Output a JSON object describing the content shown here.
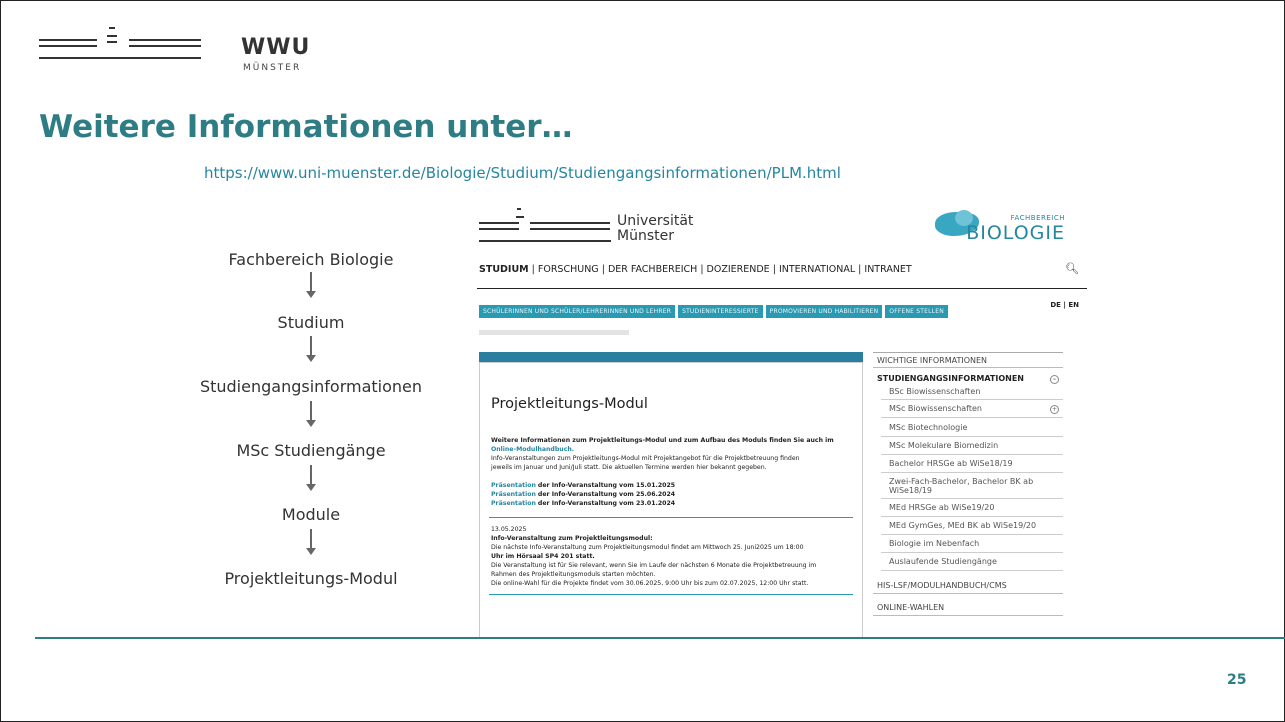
{
  "logo": {
    "word": "WWU",
    "sub": "MÜNSTER"
  },
  "title": "Weitere Informationen unter…",
  "url": "https://www.uni-muenster.de/Biologie/Studium/Studiengangsinformationen/PLM.html",
  "flow": [
    "Fachbereich Biologie",
    "Studium",
    "Studiengangsinformationen",
    "MSc Studiengänge",
    "Module",
    "Projektleitungs-Modul"
  ],
  "screenshot": {
    "uni_name_1": "Universität",
    "uni_name_2": "Münster",
    "bio_small": "FACHBEREICH",
    "bio_big": "BIOLOGIE",
    "nav": [
      "STUDIUM",
      "FORSCHUNG",
      "DER FACHBEREICH",
      "DOZIERENDE",
      "INTERNATIONAL",
      "INTRANET"
    ],
    "nav_sep": "|",
    "search_icon": "search-icon",
    "chips": [
      "SCHÜLERINNEN UND SCHÜLER/LEHRERINNEN UND LEHRER",
      "STUDIENINTERESSIERTE",
      "PROMOVIEREN UND HABILITIEREN",
      "OFFENE STELLEN"
    ],
    "lang": "DE | EN",
    "heading": "Projektleitungs-Modul",
    "intro_bold": "Weitere Informationen zum Projektleitungs-Modul und zum Aufbau des Moduls finden Sie auch im",
    "intro_link": "Online-Modulhandbuch.",
    "intro_1": "Info-Veranstaltungen zum Projektleitungs-Modul mit Projektangebot für die Projektbetreuung finden",
    "intro_2": "jeweils im Januar und Juni/Juli statt. Die aktuellen Termine werden hier bekannt gegeben.",
    "pres_label": "Präsentation",
    "pres": [
      "der Info-Veranstaltung vom 15.01.2025",
      "der Info-Veranstaltung vom 25.06.2024",
      "der Info-Veranstaltung vom 23.01.2024"
    ],
    "news_date": "13.05.2025",
    "news_title": "Info-Veranstaltung zum Projektleitungsmodul:",
    "news_1": "Die nächste Info-Veranstaltung zum Projektleitungsmodul findet am Mittwoch 25. Juni2025 um 18:00",
    "news_2": "Uhr im Hörsaal SP4 201 statt.",
    "news_3": "Die Veranstaltung ist für Sie relevant, wenn Sie im Laufe der nächsten 6 Monate die Projektbetreuung im",
    "news_4": "Rahmen des Projektleitungsmoduls starten möchten.",
    "news_5": "Die online-Wahl für die Projekte findet vom 30.06.2025, 9:00 Uhr bis zum 02.07.2025, 12:00 Uhr statt.",
    "sidebar_top": "WICHTIGE INFORMATIONEN",
    "sidebar_head": "STUDIENGANGSINFORMATIONEN",
    "sidebar_items": [
      "BSc Biowissenschaften",
      "MSc Biowissenschaften",
      "MSc Biotechnologie",
      "MSc Molekulare Biomedizin",
      "Bachelor HRSGe ab WiSe18/19",
      "Zwei-Fach-Bachelor, Bachelor BK ab",
      "WiSe18/19",
      "MEd HRSGe ab WiSe19/20",
      "MEd GymGes, MEd BK ab WiSe19/20",
      "Biologie im Nebenfach",
      "Auslaufende Studiengänge"
    ],
    "sidebar_bottom": [
      "HIS-LSF/MODULHANDBUCH/CMS",
      "ONLINE-WAHLEN"
    ]
  },
  "page_number": "25"
}
